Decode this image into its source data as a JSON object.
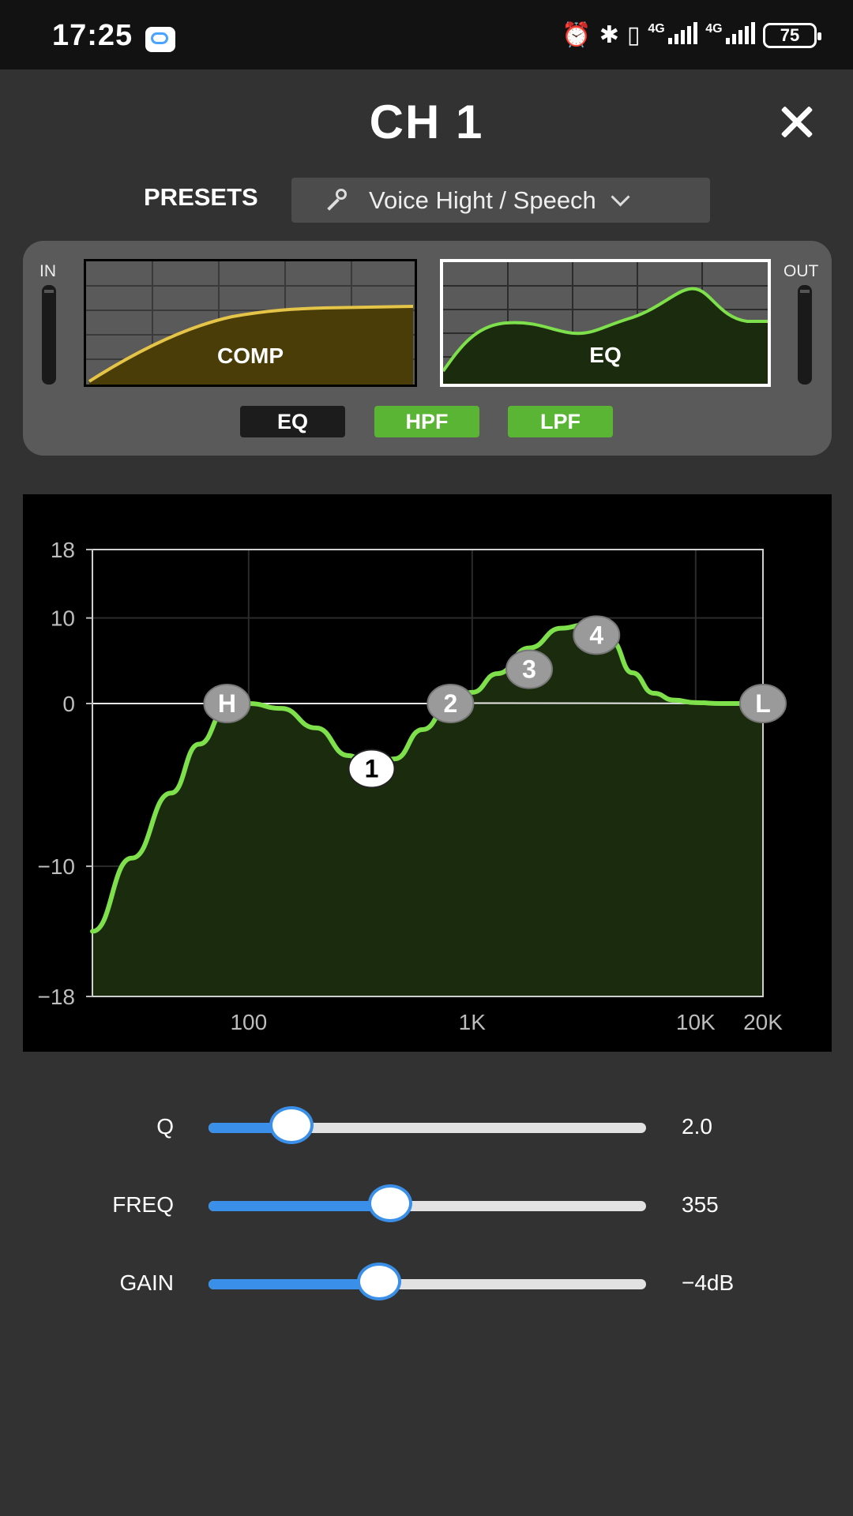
{
  "status_bar": {
    "time": "17:25",
    "net1": "4G",
    "net2": "4G",
    "battery": "75",
    "icons": [
      "chat-app-icon",
      "alarm-icon",
      "bluetooth-icon",
      "vibrate-icon",
      "signal-icon",
      "signal-icon",
      "battery-icon"
    ]
  },
  "header": {
    "title": "CH 1",
    "close_icon": "close-icon"
  },
  "presets": {
    "label": "PRESETS",
    "value": "Voice Hight / Speech",
    "icon": "microphone-icon",
    "dropdown_icon": "chevron-down-icon"
  },
  "modules": {
    "in_label": "IN",
    "out_label": "OUT",
    "comp_label": "COMP",
    "eq_label": "EQ",
    "selected": "EQ",
    "toggles": [
      {
        "label": "EQ",
        "state": "off",
        "color": "#1c1c1c"
      },
      {
        "label": "HPF",
        "state": "on",
        "color": "#5bb535"
      },
      {
        "label": "LPF",
        "state": "on",
        "color": "#5bb535"
      }
    ],
    "comp_color": "#e5c548",
    "eq_color": "#7ee04a"
  },
  "chart_data": {
    "type": "line",
    "xscale": "log",
    "xlim": [
      20,
      20000
    ],
    "ylim": [
      -18,
      18
    ],
    "xticks": [
      "100",
      "1K",
      "10K",
      "20K"
    ],
    "yticks": [
      "18",
      "10",
      "0",
      "−10",
      "−18"
    ],
    "grid": true,
    "series": [
      {
        "x": [
          20,
          30,
          45,
          60,
          80,
          100,
          140,
          200,
          280,
          355,
          450,
          600,
          800,
          1000,
          1300,
          1800,
          2500,
          3200,
          3600,
          4200,
          5200,
          6500,
          8000,
          10000,
          13000,
          17000,
          20000
        ],
        "y": [
          -14,
          -9.5,
          -5.5,
          -2.5,
          -0.3,
          0,
          -0.3,
          -1.5,
          -3.2,
          -4,
          -3.4,
          -1.6,
          0,
          1.3,
          3.5,
          6.5,
          8.8,
          9.2,
          8.9,
          7.3,
          3.6,
          1.2,
          0.4,
          0.1,
          0,
          0,
          0
        ]
      }
    ],
    "flat_line": {
      "x": [
        20,
        800,
        1000,
        1300,
        20000
      ],
      "y": [
        0,
        0,
        0.05,
        0.05,
        0
      ]
    },
    "handles": [
      {
        "label": "H",
        "freq": 80,
        "gain": 0,
        "style": "gray"
      },
      {
        "label": "1",
        "freq": 355,
        "gain": -4,
        "style": "white"
      },
      {
        "label": "2",
        "freq": 800,
        "gain": 0,
        "style": "gray"
      },
      {
        "label": "3",
        "freq": 1800,
        "gain": 4,
        "style": "gray"
      },
      {
        "label": "4",
        "freq": 3600,
        "gain": 8,
        "style": "gray"
      },
      {
        "label": "L",
        "freq": 20000,
        "gain": 0,
        "style": "gray"
      }
    ],
    "curve_color": "#7ee04a",
    "fill_color": "#1a2b0e"
  },
  "params": [
    {
      "label": "Q",
      "value": "2.0",
      "fraction": 0.19
    },
    {
      "label": "FREQ",
      "value": "355",
      "fraction": 0.415
    },
    {
      "label": "GAIN",
      "value": "−4dB",
      "fraction": 0.39
    }
  ]
}
